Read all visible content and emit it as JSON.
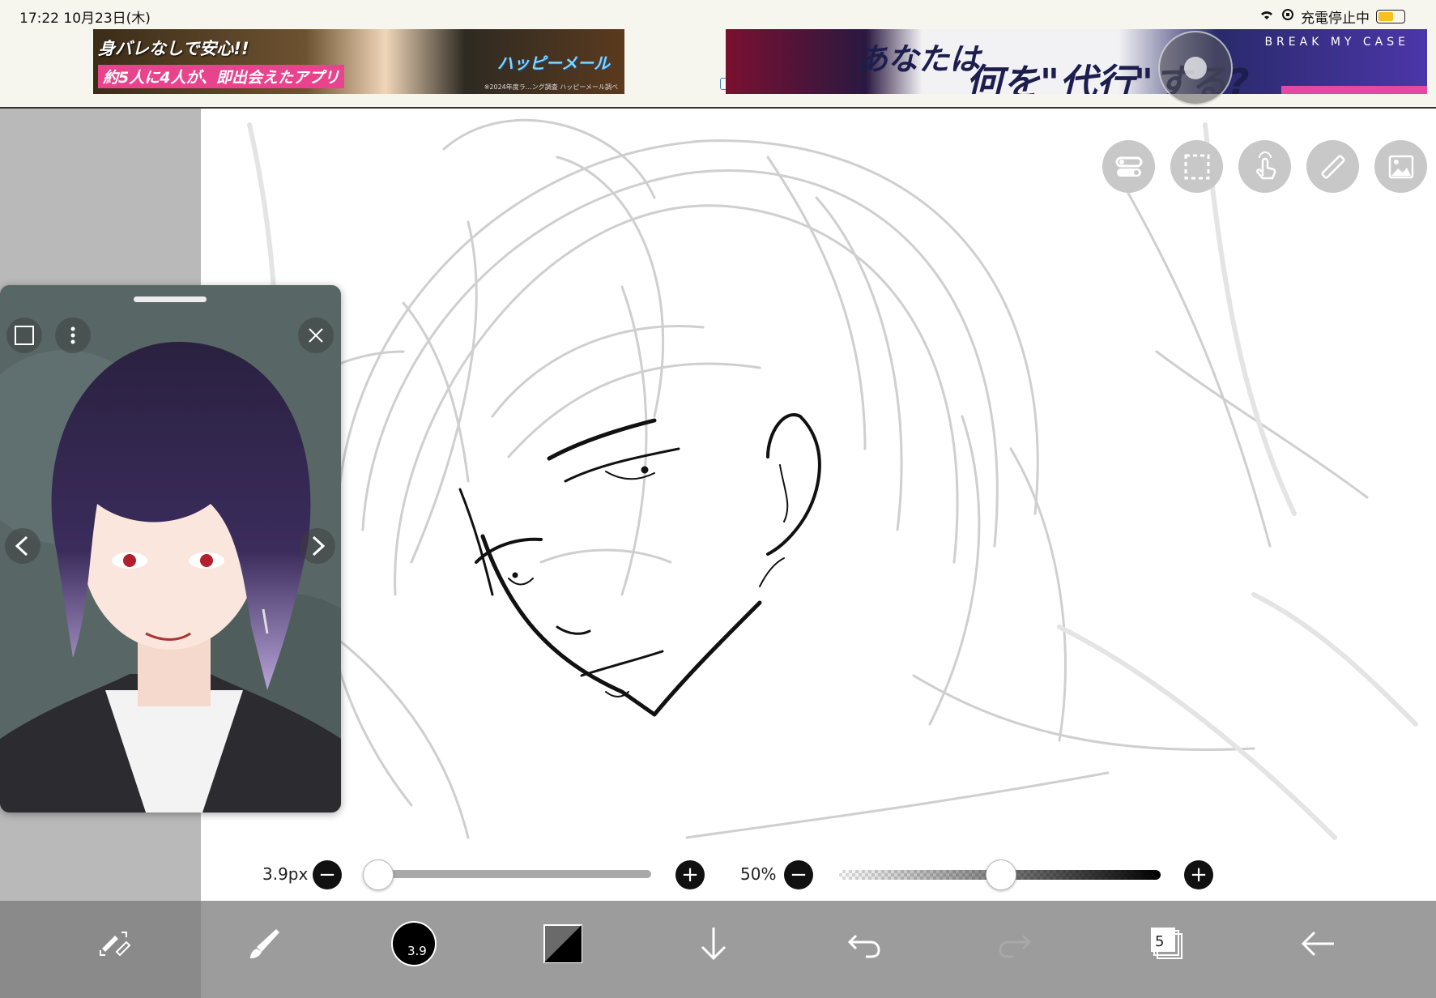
{
  "status_bar": {
    "time_date": "17:22  10月23日(木)",
    "charging_status": "充電停止中",
    "battery_level": 0.6
  },
  "ads": {
    "left": {
      "line1": "身バレなしで安心!!",
      "line2": "約5人に4人が、即出会えたアプリ",
      "logo": "ハッピーメール",
      "fineprint": "※2024年度ラ…ング調査 ハッピーメール調べ"
    },
    "right": {
      "line1": "あなたは",
      "line2": "何を\"代行\"する?",
      "brand": "BREAK MY CASE"
    }
  },
  "canvas_tools": [
    "toggle-icon",
    "selection-icon",
    "touch-icon",
    "ruler-icon",
    "reference-image-icon"
  ],
  "brush_size": {
    "label": "3.9px",
    "value": 3.9,
    "fraction": 0.0,
    "minus": "−",
    "plus": "+"
  },
  "opacity": {
    "label": "50%",
    "value": 0.5,
    "minus": "−",
    "plus": "+"
  },
  "bottom_toolbar": {
    "brush_preview_value": "3.9",
    "layers_count": "5"
  },
  "colors": {
    "accent_pen": "#000000",
    "toolbar_bg": "#808080",
    "panel_gray": "#b9b9b9"
  }
}
